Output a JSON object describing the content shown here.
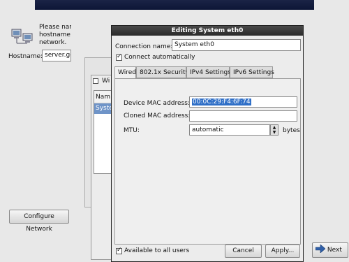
{
  "background": {
    "intro_text": "Please nam\nhostname i\nnetwork.",
    "hostname_label": "Hostname:",
    "hostname_value": "server.ge",
    "network_dialog_title_partial": "Wi",
    "list_header_partial": "Nam",
    "list_selected_partial": "Syste",
    "configure_network_label": "Configure Network",
    "next_label": "Next"
  },
  "dialog": {
    "title": "Editing System eth0",
    "connection_name_label": "Connection name:",
    "connection_name_value": "System eth0",
    "connect_automatically_label": "Connect automatically",
    "connect_automatically_checked": true,
    "tabs": [
      {
        "label": "Wired",
        "active": true
      },
      {
        "label": "802.1x Security",
        "active": false
      },
      {
        "label": "IPv4 Settings",
        "active": false
      },
      {
        "label": "IPv6 Settings",
        "active": false
      }
    ],
    "wired": {
      "device_mac_label": "Device MAC address:",
      "device_mac_value": "00:0C:29:F4:6F:74",
      "cloned_mac_label": "Cloned MAC address:",
      "cloned_mac_value": "",
      "mtu_label": "MTU:",
      "mtu_value": "automatic",
      "mtu_unit": "bytes"
    },
    "available_to_all_users_label": "Available to all users",
    "available_to_all_users_checked": true,
    "cancel_label": "Cancel",
    "apply_label": "Apply..."
  },
  "colors": {
    "banner": "#0d1636",
    "selection": "#2f6fc7",
    "titlebar": "#2a2a2a"
  }
}
